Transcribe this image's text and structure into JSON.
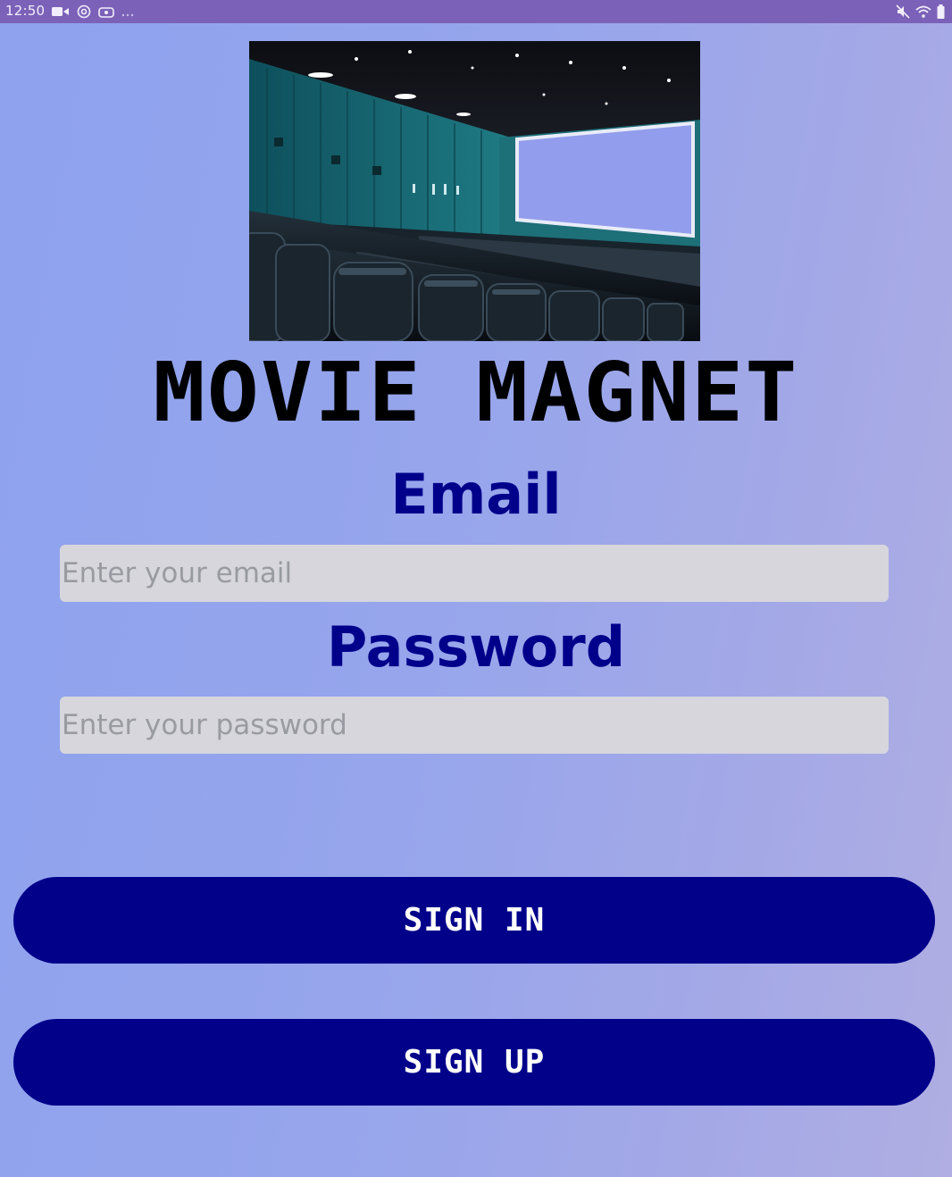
{
  "status_bar": {
    "time": "12:50",
    "left_icons": [
      "video-icon",
      "at-sign-icon",
      "cast-icon"
    ],
    "right_icons": [
      "mute-icon",
      "wifi-icon",
      "battery-icon"
    ]
  },
  "hero_image": {
    "icon": "cinema-theater-image"
  },
  "title": "MOVIE MAGNET",
  "email": {
    "label": "Email",
    "placeholder": "Enter your email",
    "value": ""
  },
  "password": {
    "label": "Password",
    "placeholder": "Enter your password",
    "value": ""
  },
  "buttons": {
    "sign_in": "SIGN IN",
    "sign_up": "SIGN UP"
  },
  "colors": {
    "status_bar": "#7b62b8",
    "label_text": "#00008b",
    "button_bg": "#01018a",
    "input_bg": "#d6d6dc"
  }
}
